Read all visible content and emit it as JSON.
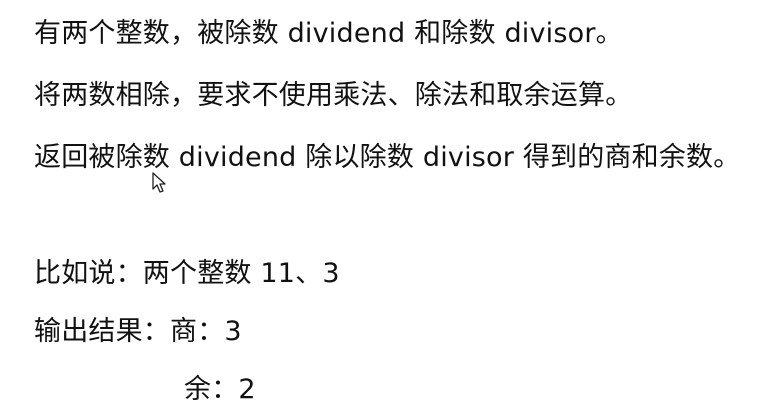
{
  "problem": {
    "line1": "有两个整数，被除数 dividend 和除数 divisor。",
    "line2": "将两数相除，要求不使用乘法、除法和取余运算。",
    "line3": "返回被除数 dividend 除以除数 divisor 得到的商和余数。"
  },
  "example": {
    "input_line": "比如说：两个整数 11、3",
    "output_line": "输出结果：商：3",
    "remainder_line": "余：2"
  },
  "icons": {
    "cursor": "mouse-pointer-icon"
  }
}
